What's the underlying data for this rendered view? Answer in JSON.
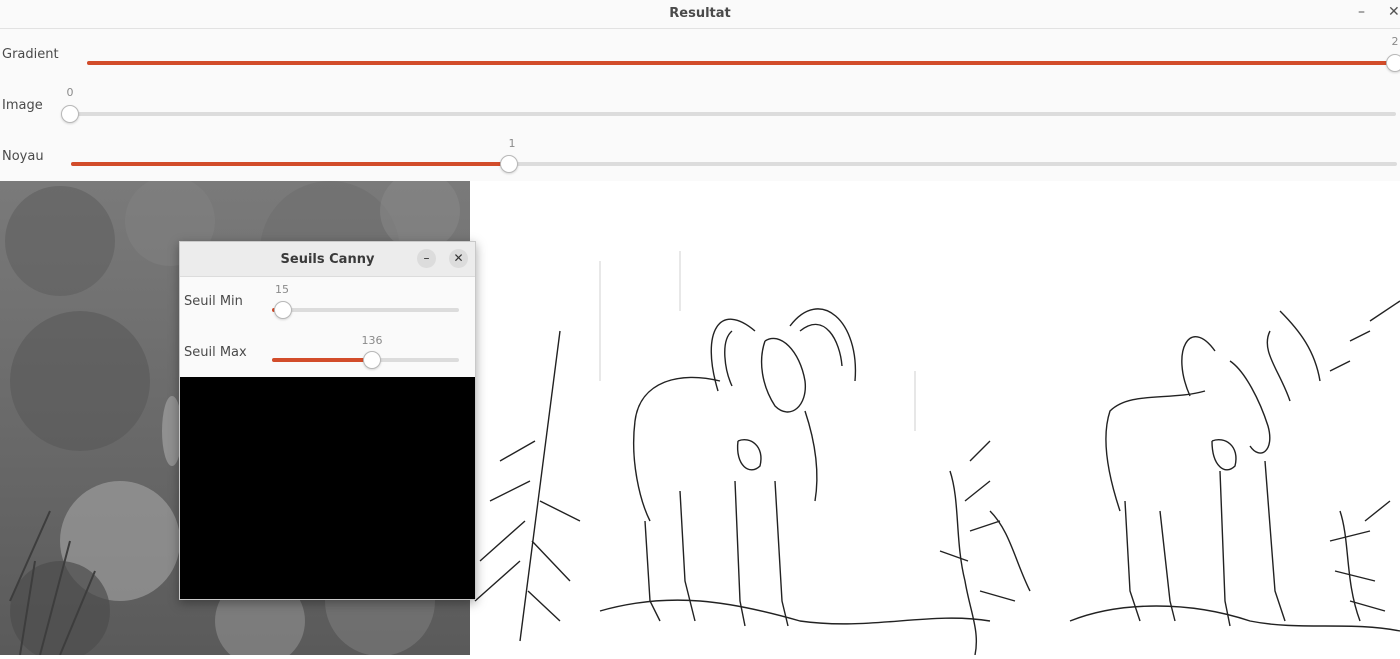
{
  "window": {
    "title": "Resultat",
    "minimize_glyph": "–",
    "close_glyph": "✕"
  },
  "sliders": [
    {
      "id": "gradient",
      "label": "Gradient",
      "value_text": "2",
      "fraction": 1.0
    },
    {
      "id": "image",
      "label": "Image",
      "value_text": "0",
      "fraction": 0.0
    },
    {
      "id": "noyau",
      "label": "Noyau",
      "value_text": "1",
      "fraction": 0.33
    }
  ],
  "dialog": {
    "title": "Seuils Canny",
    "minimize_glyph": "–",
    "close_glyph": "✕",
    "sliders": [
      {
        "id": "seuil-min",
        "label": "Seuil Min",
        "value_text": "15",
        "value": 15,
        "max": 255
      },
      {
        "id": "seuil-max",
        "label": "Seuil Max",
        "value_text": "136",
        "value": 136,
        "max": 255
      }
    ]
  },
  "colors": {
    "accent": "#d24c2a",
    "track": "#dcdcdc"
  }
}
